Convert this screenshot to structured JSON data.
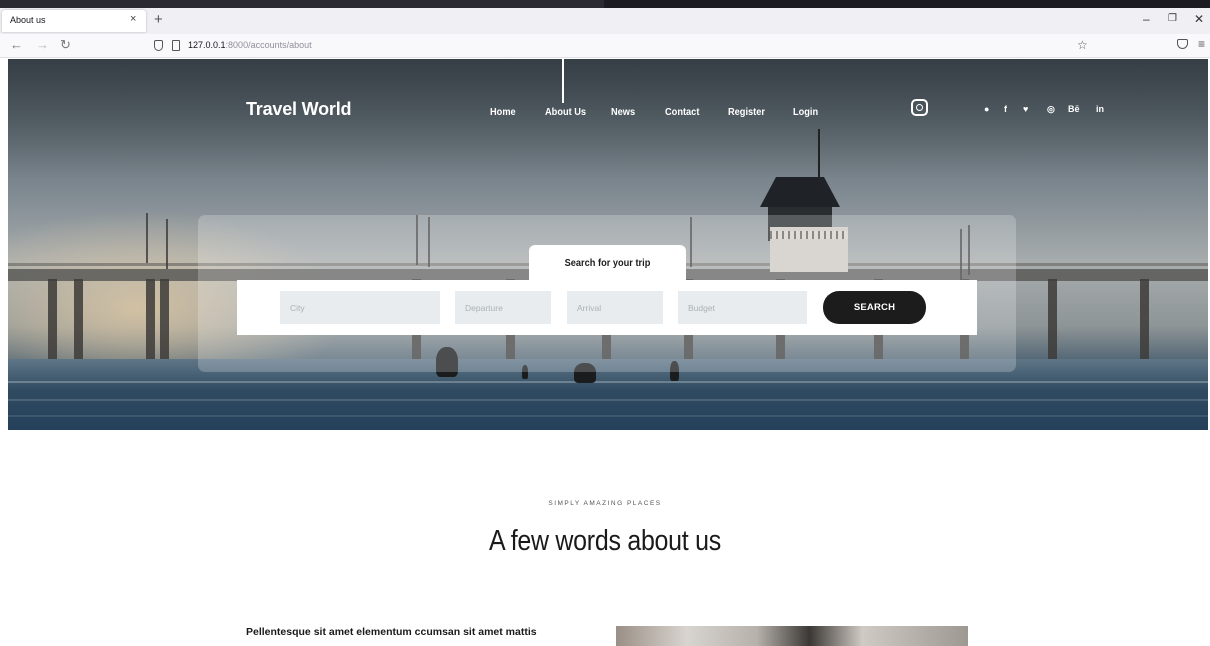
{
  "browser": {
    "tab_title": "About us",
    "tab_close": "×",
    "new_tab": "+",
    "url_host": "127.0.0.1",
    "url_path": ":8000/accounts/about",
    "controls": {
      "minimize": "–",
      "restore": "❐",
      "close": "✕"
    }
  },
  "site": {
    "brand": "Travel World",
    "nav": [
      "Home",
      "About Us",
      "News",
      "Contact",
      "Register",
      "Login"
    ],
    "social": [
      "●",
      "f",
      "♥",
      "◎",
      "Bē",
      "in"
    ]
  },
  "search": {
    "tab_label": "Search for your trip",
    "fields": [
      {
        "placeholder": "City"
      },
      {
        "placeholder": "Departure"
      },
      {
        "placeholder": "Arrival"
      },
      {
        "placeholder": "Budget"
      }
    ],
    "button_label": "SEARCH"
  },
  "about": {
    "eyebrow": "SIMPLY AMAZING PLACES",
    "title": "A few words about us",
    "lead": "Pellentesque sit amet elementum ccumsan sit amet mattis"
  }
}
